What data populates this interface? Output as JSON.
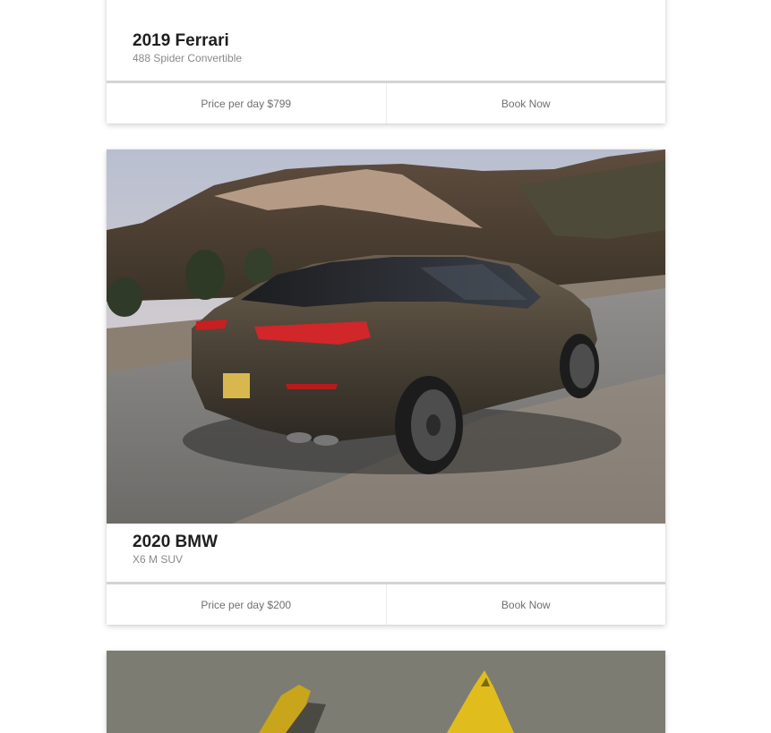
{
  "cars": [
    {
      "title": "2019 Ferrari",
      "subtitle": "488 Spider Convertible",
      "price_label": "Price per day $799",
      "book_label": "Book Now"
    },
    {
      "title": "2020 BMW",
      "subtitle": "X6 M SUV",
      "price_label": "Price per day $200",
      "book_label": "Book Now"
    },
    {
      "title": "",
      "subtitle": "",
      "price_label": "",
      "book_label": ""
    }
  ],
  "colors": {
    "footer_border": "#d4d4d4",
    "title_text": "#1f1f1f",
    "subtitle_text": "#8a8a8a",
    "footer_text": "#6f6f6f",
    "third_card_bg": "#7d7c73",
    "third_card_accent": "#d9b51f"
  },
  "icons": {
    "car_images": [
      "ferrari-image",
      "bmw-x6-image",
      "yellow-car-image"
    ]
  }
}
